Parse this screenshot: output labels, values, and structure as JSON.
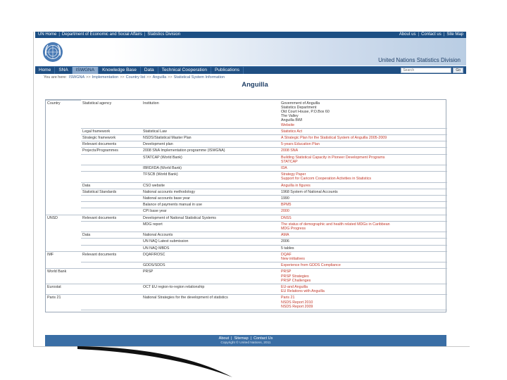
{
  "topbar": {
    "left": [
      "UN Home",
      "Department of Economic and Social Affairs",
      "Statistics Division"
    ],
    "right": [
      "About us",
      "Contact us",
      "Site Map"
    ]
  },
  "banner": {
    "title": "United Nations Statistics Division"
  },
  "nav": {
    "tabs": [
      "Home",
      "SNA",
      "ISWGNA",
      "Knowledge Base",
      "Data",
      "Technical Cooperation",
      "Publications"
    ],
    "active_tab": "ISWGNA",
    "search_placeholder": "Search",
    "search_button": "Go"
  },
  "breadcrumb": {
    "lead": "You are here:",
    "items": [
      "ISWGNA",
      "Implementation",
      "Country list",
      "Anguilla",
      "Statistical System Information"
    ]
  },
  "page": {
    "title": "Anguilla"
  },
  "table": {
    "rows": [
      {
        "c1": "Country",
        "c2": "Statistical agency",
        "c3": "Institution",
        "c4": [
          {
            "t": "Government of Anguilla",
            "link": false
          },
          {
            "t": "Statistics Department",
            "link": false
          },
          {
            "t": "Old Court House, P.O.Box 60",
            "link": false
          },
          {
            "t": "The Valley",
            "link": false
          },
          {
            "t": "Anguilla BWI",
            "link": false
          },
          {
            "t": "Website",
            "link": true
          }
        ],
        "group_start": true
      },
      {
        "c1": "",
        "c2": "Legal framework",
        "c3": "Statistical Law",
        "c4": [
          {
            "t": "Statistics Act",
            "link": true
          }
        ]
      },
      {
        "c1": "",
        "c2": "Strategic framework",
        "c3": "NSDS/Statistical Master Plan",
        "c4": [
          {
            "t": "A Strategic Plan for the Statistical System of Anguilla 2005-2009",
            "link": true
          }
        ]
      },
      {
        "c1": "",
        "c2": "Relevant documents",
        "c3": "Development plan",
        "c4": [
          {
            "t": "5-years Education Plan",
            "link": true
          }
        ]
      },
      {
        "c1": "",
        "c2": "Projects/Programmes",
        "c3": "2008 SNA Implementation programme (ISWGNA)",
        "c4": [
          {
            "t": "2008 SNA",
            "link": true
          }
        ]
      },
      {
        "c1": "",
        "c2": "",
        "c3": "STATCAP (World Bank)",
        "c4": [
          {
            "t": "Building Statistical Capacity in Pioneer Development Programs",
            "link": true
          },
          {
            "t": "STATCAP",
            "link": true
          }
        ]
      },
      {
        "c1": "",
        "c2": "",
        "c3": "IBRD/IDA (World Bank)",
        "c4": [
          {
            "t": "IDA",
            "link": true
          }
        ]
      },
      {
        "c1": "",
        "c2": "",
        "c3": "TFSCB (World Bank)",
        "c4": [
          {
            "t": "Strategy Paper",
            "link": true
          },
          {
            "t": "Support for Caricom Cooperation Activities in Statistics",
            "link": true
          }
        ]
      },
      {
        "c1": "",
        "c2": "Data",
        "c3": "CSO website",
        "c4": [
          {
            "t": "Anguilla in figures",
            "link": true
          }
        ]
      },
      {
        "c1": "",
        "c2": "Statistical Standards",
        "c3": "National accounts methodology",
        "c4": [
          {
            "t": "1968 System of National Accounts",
            "link": false
          }
        ]
      },
      {
        "c1": "",
        "c2": "",
        "c3": "National accounts base year",
        "c4": [
          {
            "t": "1990",
            "link": false
          }
        ]
      },
      {
        "c1": "",
        "c2": "",
        "c3": "Balance of payments manual in use",
        "c4": [
          {
            "t": "BPM5",
            "link": true
          }
        ]
      },
      {
        "c1": "",
        "c2": "",
        "c3": "CPI base year",
        "c4": [
          {
            "t": "2000",
            "link": true
          }
        ]
      },
      {
        "c1": "UNSD",
        "c2": "Relevant documents",
        "c3": "Development of National Statistical Systems",
        "c4": [
          {
            "t": "DNSS",
            "link": true
          }
        ],
        "group_start": true
      },
      {
        "c1": "",
        "c2": "",
        "c3": "MDG report",
        "c4": [
          {
            "t": "The status of demographic and health related MDGs in Caribbean",
            "link": true
          },
          {
            "t": "MDG Progress",
            "link": true
          }
        ]
      },
      {
        "c1": "",
        "c2": "Data",
        "c3": "National Accounts",
        "c4": [
          {
            "t": "AMA",
            "link": true
          }
        ]
      },
      {
        "c1": "",
        "c2": "",
        "c3": "UN NAQ Latest submission",
        "c4": [
          {
            "t": "2006",
            "link": false
          }
        ]
      },
      {
        "c1": "",
        "c2": "",
        "c3": "UN NAQ MBDS",
        "c4": [
          {
            "t": "5 tables",
            "link": false
          }
        ]
      },
      {
        "c1": "IMF",
        "c2": "Relevant documents",
        "c3": "DQAF/ROSC",
        "c4": [
          {
            "t": "DQAF",
            "link": true
          },
          {
            "t": "New initiatives",
            "link": true
          }
        ],
        "group_start": true
      },
      {
        "c1": "",
        "c2": "",
        "c3": "GDDS/SDDS",
        "c4": [
          {
            "t": "Experience from GDDS Compliance",
            "link": true
          }
        ]
      },
      {
        "c1": "World Bank",
        "c2": "",
        "c3": "PRSP",
        "c4": [
          {
            "t": "PRSP",
            "link": true
          },
          {
            "t": "PRSP Strategies",
            "link": true
          },
          {
            "t": "PRSP Challenges",
            "link": true
          }
        ],
        "group_start": true
      },
      {
        "c1": "Eurostat",
        "c2": "",
        "c3": "OCT EU region-to-region relationship",
        "c4": [
          {
            "t": "EU-and Anguilla",
            "link": true
          },
          {
            "t": "EU Relations with Anguilla",
            "link": true
          }
        ],
        "group_start": true
      },
      {
        "c1": "Paris 21",
        "c2": "",
        "c3": "National Strategies for the development of statistics",
        "c4": [
          {
            "t": "Paris 21",
            "link": true
          },
          {
            "t": "NSDS Report 2010",
            "link": true
          },
          {
            "t": "NSDS Report 2009",
            "link": true
          }
        ],
        "group_start": true
      }
    ]
  },
  "footer": {
    "links": [
      "About",
      "Sitemap",
      "Contact Us"
    ],
    "copyright": "Copyright © United Nations, 2011"
  },
  "colors": {
    "nav_bg": "#1f4f83",
    "link_red": "#c0392b",
    "footer_bg": "#3a6ea5"
  }
}
